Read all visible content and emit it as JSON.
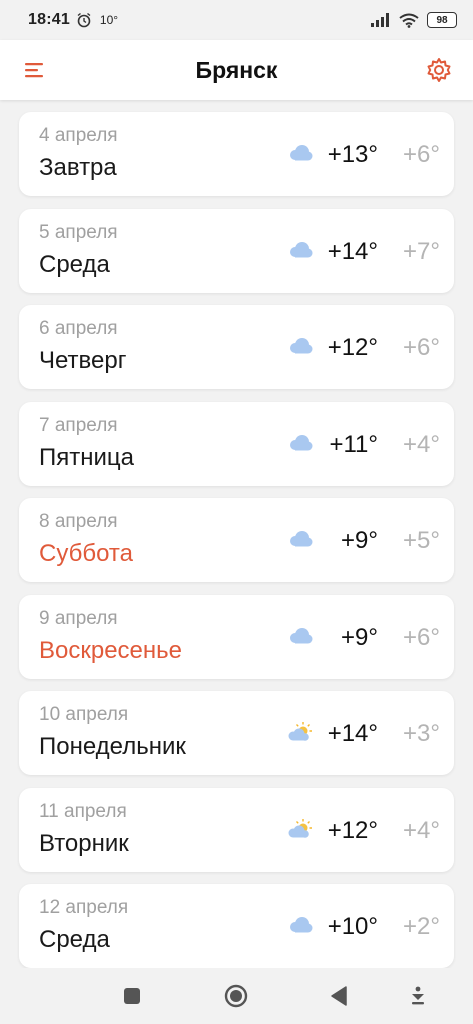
{
  "status_bar": {
    "time": "18:41",
    "temperature": "10°",
    "battery": "98"
  },
  "header": {
    "title": "Брянск",
    "menu_icon": "hamburger-menu-icon",
    "settings_icon": "gear-icon"
  },
  "colors": {
    "accent": "#e05a3a",
    "weekend": "#e05a3a",
    "muted": "#a0a0a0",
    "low_temp": "#b4b4b4"
  },
  "forecast": [
    {
      "date": "4 апреля",
      "day": "Завтра",
      "high": "+13°",
      "low": "+6°",
      "icon": "cloudy-icon",
      "weekend": false
    },
    {
      "date": "5 апреля",
      "day": "Среда",
      "high": "+14°",
      "low": "+7°",
      "icon": "cloudy-icon",
      "weekend": false
    },
    {
      "date": "6 апреля",
      "day": "Четверг",
      "high": "+12°",
      "low": "+6°",
      "icon": "cloudy-icon",
      "weekend": false
    },
    {
      "date": "7 апреля",
      "day": "Пятница",
      "high": "+11°",
      "low": "+4°",
      "icon": "cloudy-icon",
      "weekend": false
    },
    {
      "date": "8 апреля",
      "day": "Суббота",
      "high": "+9°",
      "low": "+5°",
      "icon": "cloudy-icon",
      "weekend": true
    },
    {
      "date": "9 апреля",
      "day": "Воскресенье",
      "high": "+9°",
      "low": "+6°",
      "icon": "cloudy-icon",
      "weekend": true
    },
    {
      "date": "10 апреля",
      "day": "Понедельник",
      "high": "+14°",
      "low": "+3°",
      "icon": "partly-sunny-icon",
      "weekend": false
    },
    {
      "date": "11 апреля",
      "day": "Вторник",
      "high": "+12°",
      "low": "+4°",
      "icon": "partly-sunny-icon",
      "weekend": false
    },
    {
      "date": "12 апреля",
      "day": "Среда",
      "high": "+10°",
      "low": "+2°",
      "icon": "cloudy-icon",
      "weekend": false
    }
  ],
  "nav_bar": {
    "recents_icon": "square-recents-icon",
    "home_icon": "circle-home-icon",
    "back_icon": "triangle-back-icon",
    "extra_icon": "download-arrow-icon"
  }
}
